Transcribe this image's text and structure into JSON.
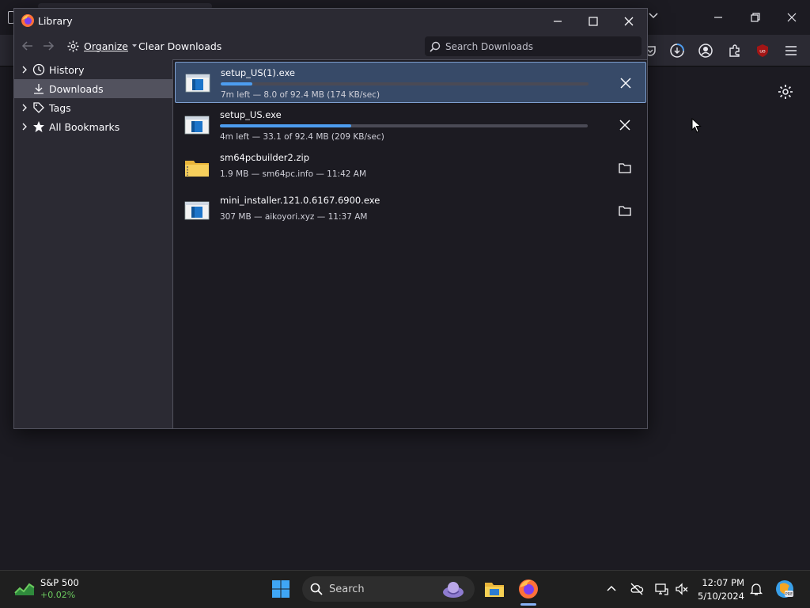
{
  "library": {
    "title": "Library",
    "toolbar": {
      "organize_label": "Organize",
      "clear_downloads_label": "Clear Downloads",
      "search_placeholder": "Search Downloads"
    },
    "sidebar": {
      "items": [
        {
          "label": "History",
          "icon": "clock-icon",
          "expandable": true,
          "selected": false
        },
        {
          "label": "Downloads",
          "icon": "download-icon",
          "expandable": false,
          "selected": true
        },
        {
          "label": "Tags",
          "icon": "tag-icon",
          "expandable": true,
          "selected": false
        },
        {
          "label": "All Bookmarks",
          "icon": "star-icon",
          "expandable": true,
          "selected": false
        }
      ]
    },
    "downloads": [
      {
        "name": "setup_US(1).exe",
        "status": "7m left — 8.0 of 92.4 MB (174 KB/sec)",
        "progress": 0.087,
        "in_progress": true,
        "action": "cancel",
        "type": "exe"
      },
      {
        "name": "setup_US.exe",
        "status": "4m left — 33.1 of 92.4 MB (209 KB/sec)",
        "progress": 0.358,
        "in_progress": true,
        "action": "cancel",
        "type": "exe"
      },
      {
        "name": "sm64pcbuilder2.zip",
        "status": "1.9 MB — sm64pc.info — 11:42 AM",
        "progress": 1,
        "in_progress": false,
        "action": "open-folder",
        "type": "zip"
      },
      {
        "name": "mini_installer.121.0.6167.6900.exe",
        "status": "307 MB — aikoyori.xyz — 11:37 AM",
        "progress": 1,
        "in_progress": false,
        "action": "open-folder",
        "type": "exe"
      }
    ]
  },
  "taskbar": {
    "stock_name": "S&P 500",
    "stock_change": "+0.02%",
    "search_placeholder": "Search",
    "clock_time": "12:07 PM",
    "clock_date": "5/10/2024"
  },
  "colors": {
    "accent": "#4d9df0",
    "selected_row": "#374a68",
    "window_bg": "#2b2a33",
    "pane_bg": "#1c1b22"
  }
}
